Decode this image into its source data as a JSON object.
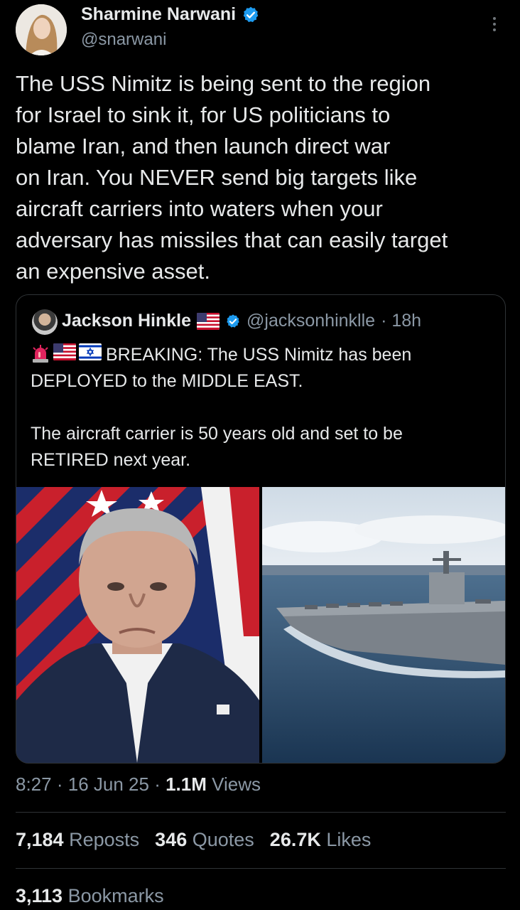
{
  "author": {
    "name": "Sharmine Narwani",
    "handle": "@snarwani",
    "verified": true
  },
  "tweet": {
    "text": "The USS Nimitz is being sent to the region\nfor Israel to sink it, for US politicians to\nblame Iran, and then launch direct war\non Iran. You NEVER send big targets like\naircraft carriers into waters when your\nadversary has missiles that can easily target\nan expensive asset."
  },
  "quote": {
    "name": "Jackson Hinkle",
    "handle": "@jacksonhinklle",
    "time": "· 18h",
    "name_flag_icon": "us-flag-icon",
    "text_icons": [
      "siren-icon",
      "us-flag-icon",
      "israel-flag-icon"
    ],
    "text_line1": "BREAKING: The USS Nimitz has been",
    "text_line2": "DEPLOYED to the MIDDLE EAST.",
    "text_para2": "The aircraft carrier is 50 years old and set to be\nRETIRED next year."
  },
  "meta": {
    "time": "8:27",
    "date": "16 Jun 25",
    "views_count": "1.1M",
    "views_label": "Views"
  },
  "stats": {
    "reposts_count": "7,184",
    "reposts_label": "Reposts",
    "quotes_count": "346",
    "quotes_label": "Quotes",
    "likes_count": "26.7K",
    "likes_label": "Likes",
    "bookmarks_count": "3,113",
    "bookmarks_label": "Bookmarks"
  },
  "colors": {
    "background": "#000000",
    "text": "#e7e9ea",
    "secondary": "#8b98a5",
    "verified": "#1d9bf0",
    "divider": "#2f3336"
  }
}
